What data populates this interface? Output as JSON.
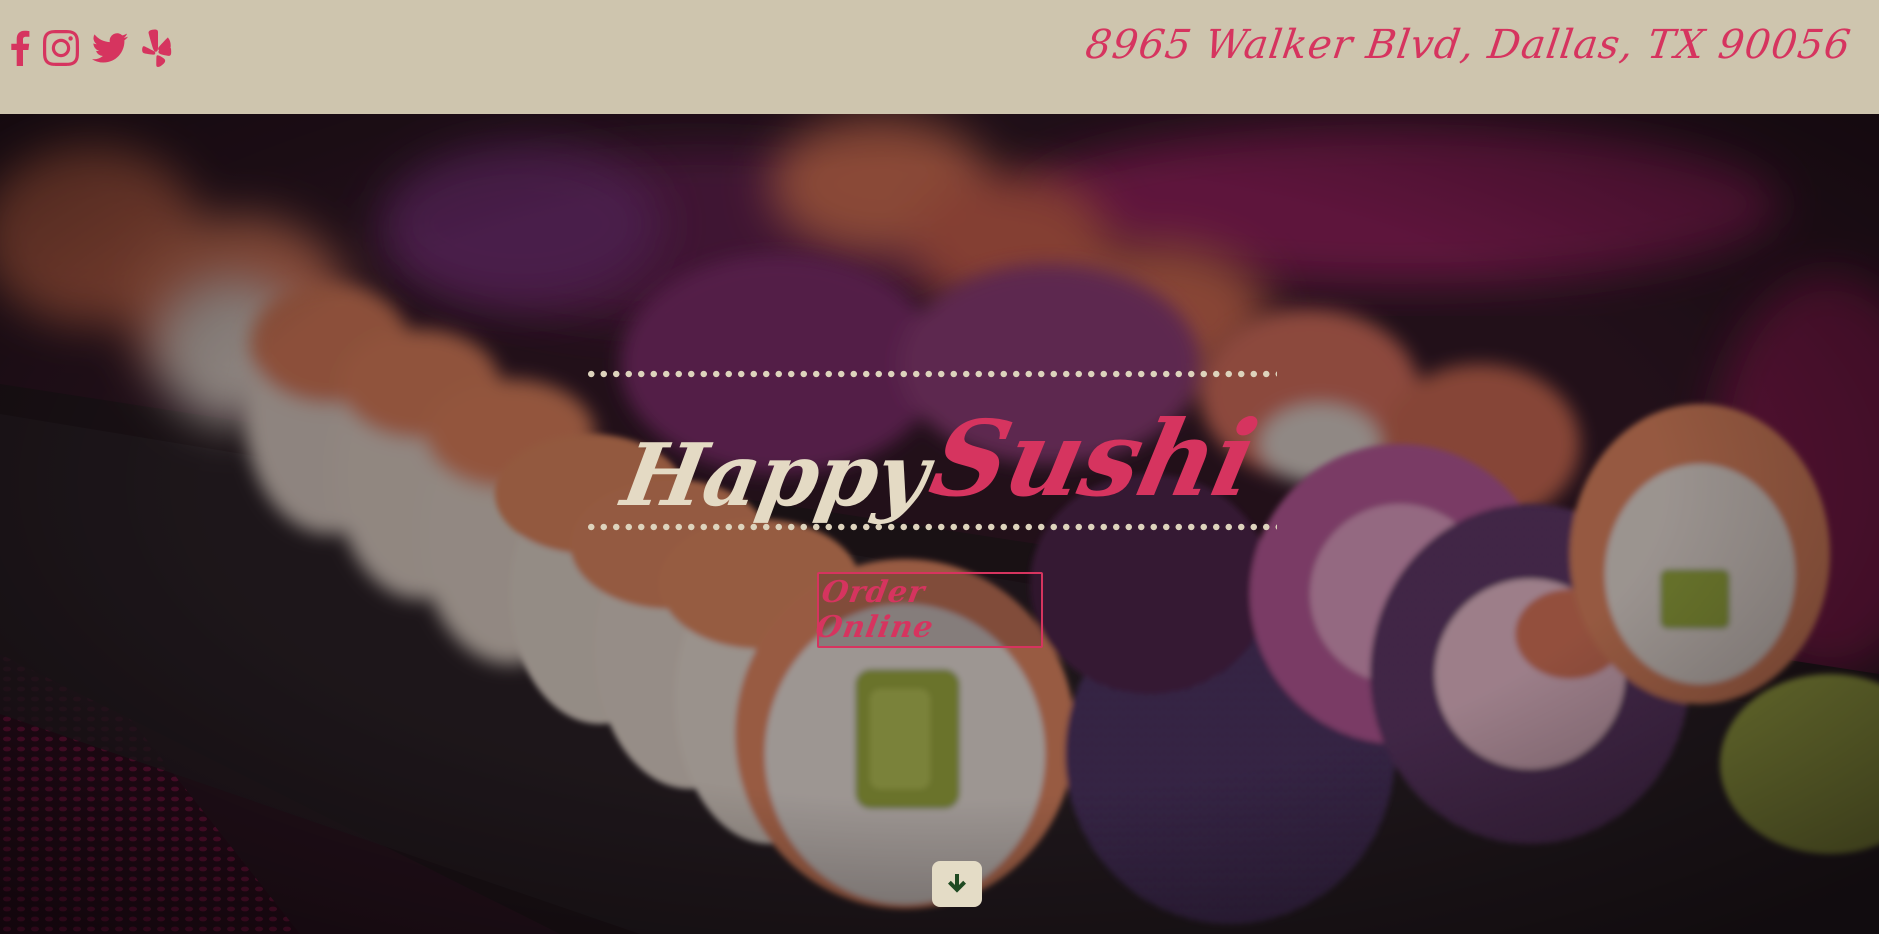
{
  "header": {
    "social_icons": [
      "facebook-icon",
      "instagram-icon",
      "twitter-icon",
      "yelp-icon"
    ],
    "address": "8965 Walker Blvd, Dallas, TX 90056"
  },
  "hero": {
    "title_word_1": "Happy",
    "title_word_2": "Sushi",
    "order_button_label": "Order Online",
    "scroll_icon": "arrow-down-icon"
  },
  "colors": {
    "topbar_bg": "#cec5ae",
    "accent": "#d6345f",
    "cream": "#e4dac4",
    "scroll_arrow": "#1f4a22"
  }
}
